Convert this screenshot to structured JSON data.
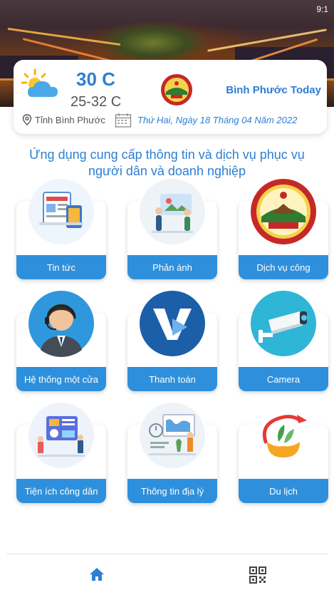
{
  "status_bar": {
    "time": "9:1"
  },
  "weather": {
    "temp_now": "30 C",
    "temp_range": "25-32 C",
    "location": "Tỉnh Bình Phước",
    "date": "Thứ Hai, Ngày 18 Tháng 04 Năm 2022",
    "icon": "sun-cloud-icon"
  },
  "app": {
    "name": "Bình Phước Today"
  },
  "headline": "Ứng dụng cung cấp thông tin và dịch vụ phục vụ người dân và doanh nghiệp",
  "services": [
    {
      "label": "Tin tức",
      "icon": "news-icon"
    },
    {
      "label": "Phản ánh",
      "icon": "feedback-icon"
    },
    {
      "label": "Dịch vụ công",
      "icon": "public-service-icon"
    },
    {
      "label": "Hệ thống một cửa",
      "icon": "one-stop-icon"
    },
    {
      "label": "Thanh toán",
      "icon": "payment-icon"
    },
    {
      "label": "Camera",
      "icon": "camera-icon"
    },
    {
      "label": "Tiện ích công dân",
      "icon": "citizen-utility-icon"
    },
    {
      "label": "Thông tin địa lý",
      "icon": "geo-info-icon"
    },
    {
      "label": "Du lịch",
      "icon": "travel-icon"
    }
  ],
  "nav": {
    "home_icon": "home-icon",
    "qr_icon": "qr-code-icon"
  },
  "colors": {
    "accent": "#2d7fd3",
    "tile_bar": "#2e90dc"
  }
}
